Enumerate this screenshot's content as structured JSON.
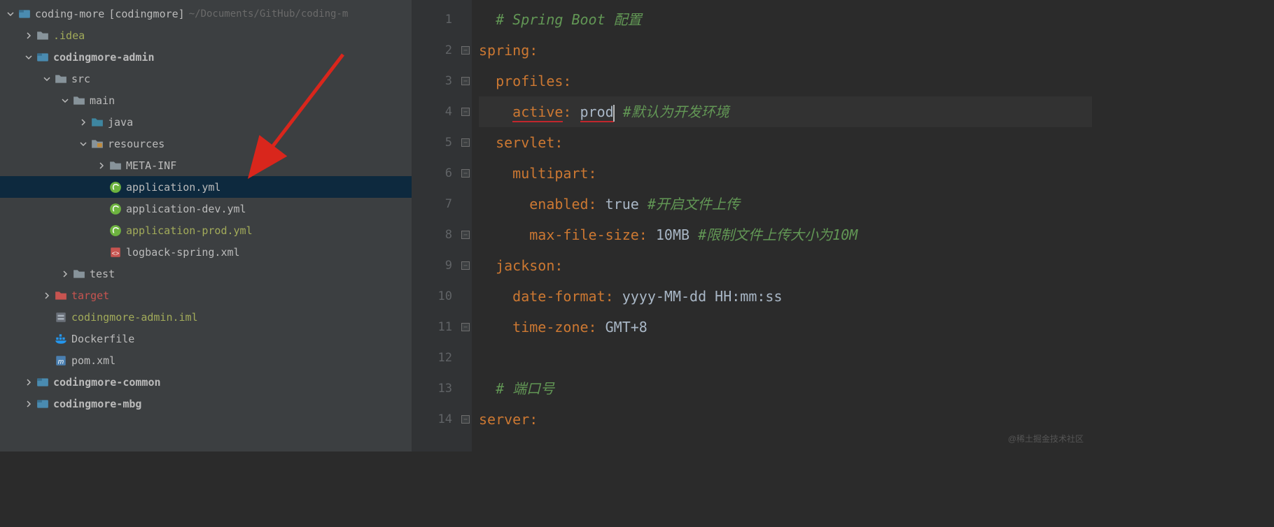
{
  "project": {
    "root_name": "coding-more",
    "root_suffix": "[codingmore]",
    "root_path": "~/Documents/GitHub/coding-m"
  },
  "tree": {
    "idea": ".idea",
    "admin": "codingmore-admin",
    "src": "src",
    "main": "main",
    "java": "java",
    "resources": "resources",
    "metainf": "META-INF",
    "app_yml": "application.yml",
    "app_dev": "application-dev.yml",
    "app_prod": "application-prod.yml",
    "logback": "logback-spring.xml",
    "test": "test",
    "target": "target",
    "iml": "codingmore-admin.iml",
    "docker": "Dockerfile",
    "pom": "pom.xml",
    "common": "codingmore-common",
    "mbg": "codingmore-mbg"
  },
  "code": {
    "l1_comment": "# Spring Boot 配置",
    "l2_key": "spring",
    "l3_key": "profiles",
    "l4_key": "active",
    "l4_val": "prod",
    "l4_comment": "#默认为开发环境",
    "l5_key": "servlet",
    "l6_key": "multipart",
    "l7_key": "enabled",
    "l7_val": "true",
    "l7_comment": "#开启文件上传",
    "l8_key": "max-file-size",
    "l8_val": "10MB",
    "l8_comment": "#限制文件上传大小为10M",
    "l9_key": "jackson",
    "l10_key": "date-format",
    "l10_val": "yyyy-MM-dd HH:mm:ss",
    "l11_key": "time-zone",
    "l11_val": "GMT+8",
    "l13_comment": "# 端口号",
    "l14_key": "server"
  },
  "watermark": "@稀土掘金技术社区"
}
